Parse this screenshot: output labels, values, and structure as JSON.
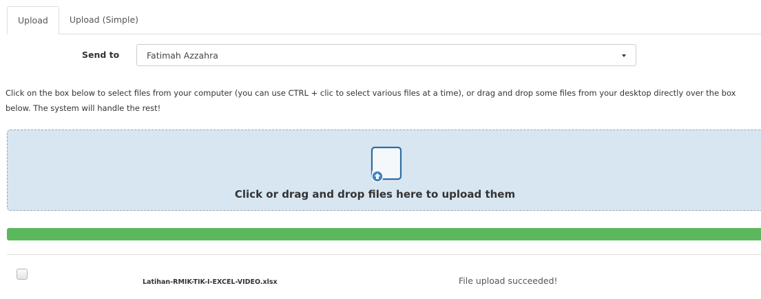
{
  "tabs": [
    {
      "label": "Upload",
      "active": true
    },
    {
      "label": "Upload (Simple)",
      "active": false
    }
  ],
  "send_to": {
    "label": "Send to",
    "selected": "Fatimah Azzahra"
  },
  "instructions": "Click on the box below to select files from your computer (you can use CTRL + clic to select various files at a time), or drag and drop some files from your desktop directly over the box below. The system will handle the rest!",
  "dropzone": {
    "text": "Click or drag and drop files here to upload them",
    "icon": "file-upload-icon"
  },
  "progress": {
    "percent": 100,
    "color": "#5cb85c"
  },
  "files": [
    {
      "name": "Latihan-RMIK-TIK-I-EXCEL-VIDEO.xlsx",
      "status": "File upload succeeded!"
    }
  ],
  "colors": {
    "dropzone_bg": "#d8e6f1",
    "progress_fill": "#5cb85c"
  }
}
